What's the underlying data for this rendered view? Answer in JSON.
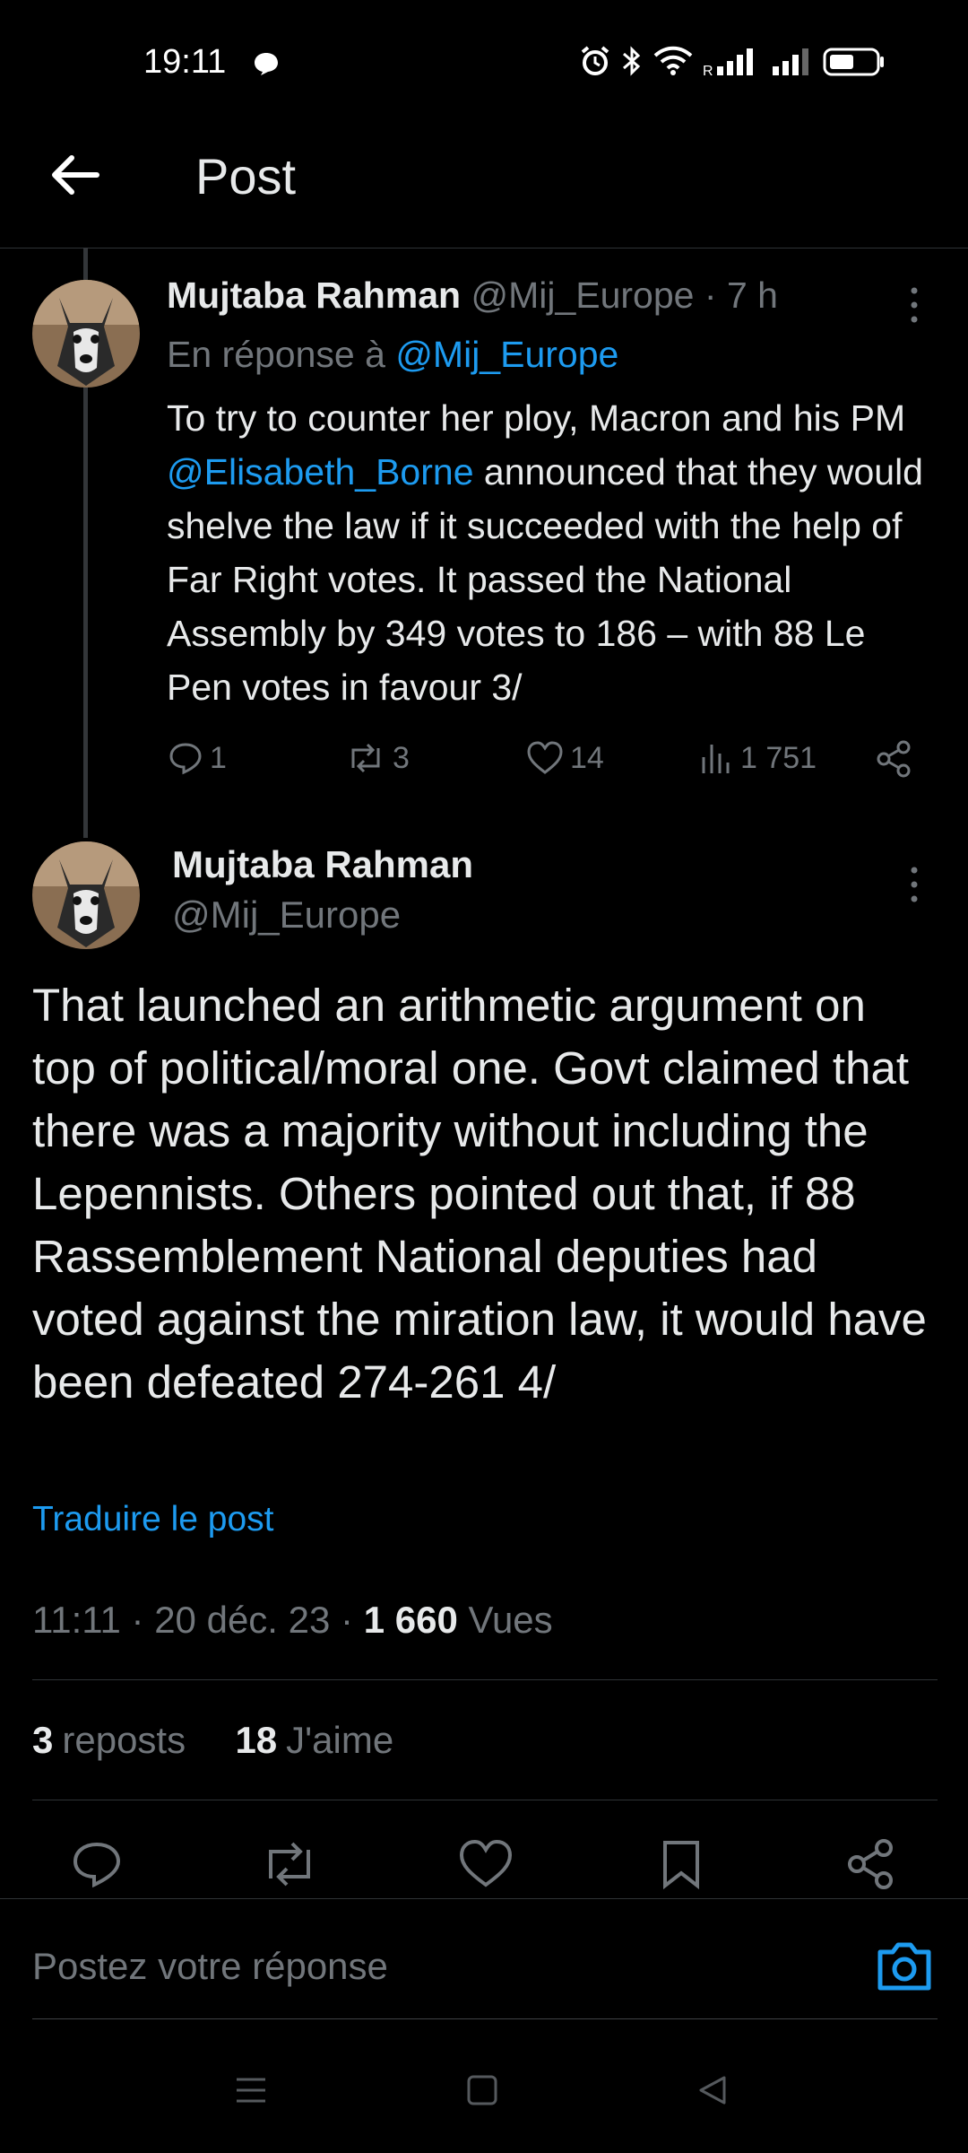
{
  "status_bar": {
    "time": "19:11"
  },
  "header": {
    "title": "Post"
  },
  "reply_tweet": {
    "author_name": "Mujtaba Rahman",
    "handle": "@Mij_Europe",
    "separator": "·",
    "time_ago": "7 h",
    "reply_prefix": "En réponse à",
    "reply_to": "@Mij_Europe",
    "body_part1": "To try to counter her ploy, Macron and his PM ",
    "mention": "@Elisabeth_Borne",
    "body_part2": "  announced that they would shelve the law if it succeeded with the help of Far Right votes. It passed the National Assembly by 349 votes to 186 – with 88 Le Pen votes in favour 3/",
    "replies": "1",
    "reposts": "3",
    "likes": "14",
    "views": "1 751"
  },
  "main_tweet": {
    "author_name": "Mujtaba Rahman",
    "handle": "@Mij_Europe",
    "body": "That launched an arithmetic argument on top of political/moral one. Govt claimed that there was a majority without including the Lepennists. Others pointed out that, if 88 Rassemblement National deputies had voted against the miration law, it would have been defeated 274-261 4/",
    "translate_label": "Traduire le post",
    "time": "11:11",
    "date": "20 déc. 23",
    "views_count": "1 660",
    "views_label": "Vues",
    "reposts_count": "3",
    "reposts_label": "reposts",
    "likes_count": "18",
    "likes_label": "J'aime"
  },
  "reply_bar": {
    "placeholder": "Postez votre réponse"
  },
  "colors": {
    "accent": "#1d9bf0",
    "background": "#000000",
    "muted": "#71767b",
    "text": "#e7e9ea"
  }
}
